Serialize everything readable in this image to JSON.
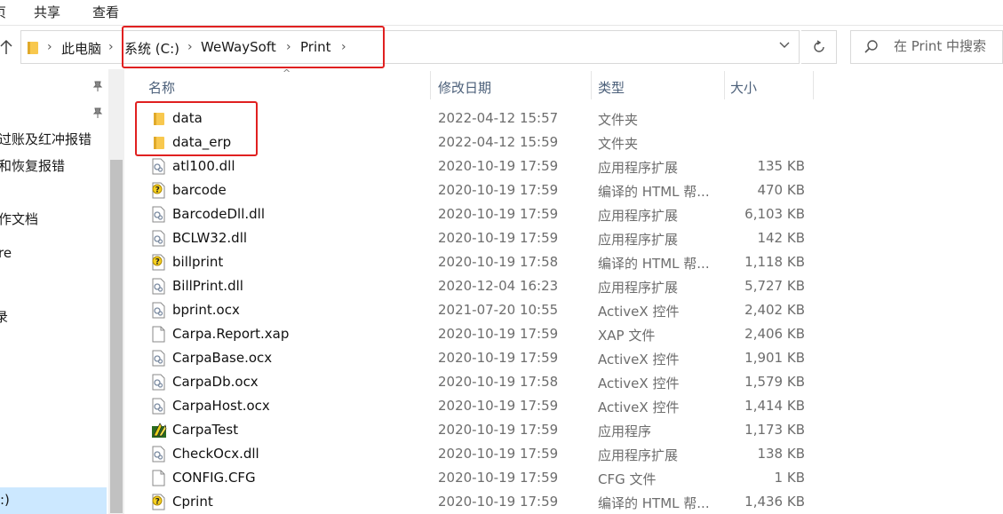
{
  "ribbon": {
    "tab_view_partial": "页",
    "tab_share": "共享",
    "tab_view": "查看"
  },
  "address": {
    "crumbs": [
      "此电脑",
      "系统 (C:)",
      "WeWaySoft",
      "Print"
    ]
  },
  "search": {
    "placeholder": "在 Print 中搜索"
  },
  "nav": {
    "items": [
      "过账及红冲报错",
      "和恢复报错",
      "作文档",
      "re",
      "录",
      ":)"
    ]
  },
  "columns": {
    "name": "名称",
    "date": "修改日期",
    "type": "类型",
    "size": "大小"
  },
  "files": [
    {
      "name": "data",
      "date": "2022-04-12 15:57",
      "type": "文件夹",
      "size": "",
      "icon": "folder-icon"
    },
    {
      "name": "data_erp",
      "date": "2022-04-12 15:59",
      "type": "文件夹",
      "size": "",
      "icon": "folder-icon"
    },
    {
      "name": "atl100.dll",
      "date": "2020-10-19 17:59",
      "type": "应用程序扩展",
      "size": "135 KB",
      "icon": "dll-icon"
    },
    {
      "name": "barcode",
      "date": "2020-10-19 17:59",
      "type": "编译的 HTML 帮...",
      "size": "470 KB",
      "icon": "help-file-icon"
    },
    {
      "name": "BarcodeDll.dll",
      "date": "2020-10-19 17:59",
      "type": "应用程序扩展",
      "size": "6,103 KB",
      "icon": "dll-icon"
    },
    {
      "name": "BCLW32.dll",
      "date": "2020-10-19 17:59",
      "type": "应用程序扩展",
      "size": "142 KB",
      "icon": "dll-icon"
    },
    {
      "name": "billprint",
      "date": "2020-10-19 17:58",
      "type": "编译的 HTML 帮...",
      "size": "1,118 KB",
      "icon": "help-file-icon"
    },
    {
      "name": "BillPrint.dll",
      "date": "2020-12-04 16:23",
      "type": "应用程序扩展",
      "size": "5,727 KB",
      "icon": "dll-icon"
    },
    {
      "name": "bprint.ocx",
      "date": "2021-07-20 10:55",
      "type": "ActiveX 控件",
      "size": "2,402 KB",
      "icon": "dll-icon"
    },
    {
      "name": "Carpa.Report.xap",
      "date": "2020-10-19 17:59",
      "type": "XAP 文件",
      "size": "2,406 KB",
      "icon": "blank-file-icon"
    },
    {
      "name": "CarpaBase.ocx",
      "date": "2020-10-19 17:59",
      "type": "ActiveX 控件",
      "size": "1,901 KB",
      "icon": "dll-icon"
    },
    {
      "name": "CarpaDb.ocx",
      "date": "2020-10-19 17:58",
      "type": "ActiveX 控件",
      "size": "1,579 KB",
      "icon": "dll-icon"
    },
    {
      "name": "CarpaHost.ocx",
      "date": "2020-10-19 17:59",
      "type": "ActiveX 控件",
      "size": "1,414 KB",
      "icon": "dll-icon"
    },
    {
      "name": "CarpaTest",
      "date": "2020-10-19 17:59",
      "type": "应用程序",
      "size": "1,173 KB",
      "icon": "app-icon"
    },
    {
      "name": "CheckOcx.dll",
      "date": "2020-10-19 17:59",
      "type": "应用程序扩展",
      "size": "138 KB",
      "icon": "dll-icon"
    },
    {
      "name": "CONFIG.CFG",
      "date": "2020-10-19 17:59",
      "type": "CFG 文件",
      "size": "1 KB",
      "icon": "blank-file-icon"
    },
    {
      "name": "Cprint",
      "date": "2020-10-19 17:59",
      "type": "编译的 HTML 帮...",
      "size": "1,436 KB",
      "icon": "help-file-icon"
    }
  ],
  "colors": {
    "highlight": "#e02020",
    "header_text": "#4c607a",
    "folder": "#f8c84e",
    "selection": "#cce8ff"
  }
}
